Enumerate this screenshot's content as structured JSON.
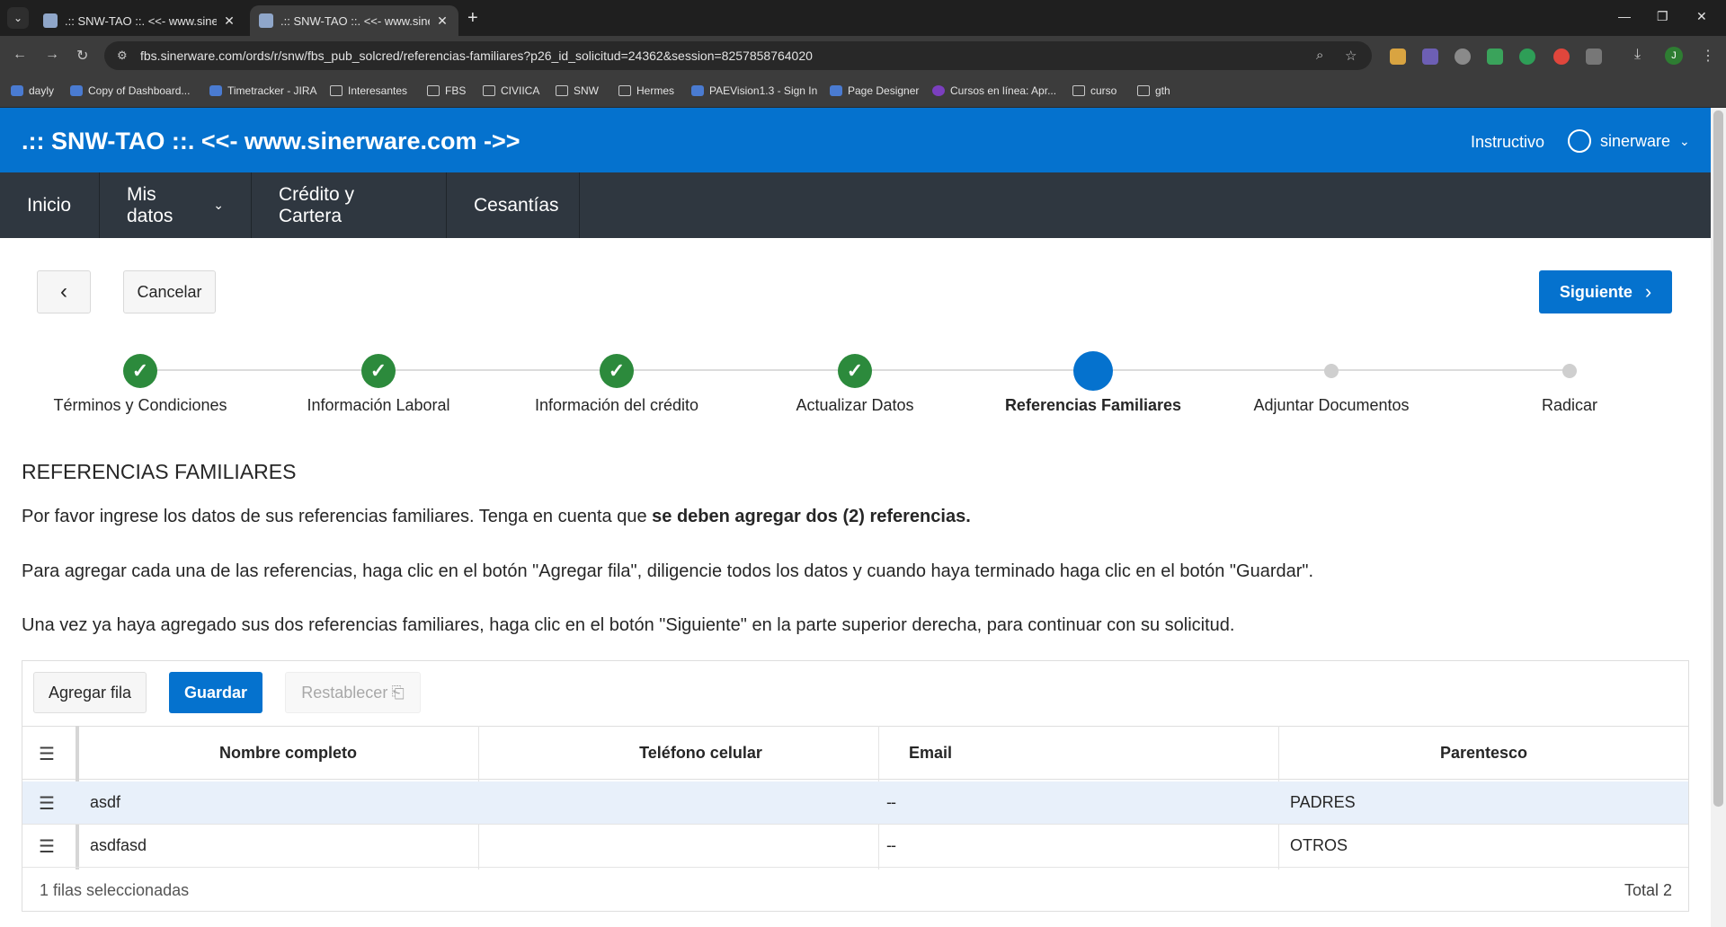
{
  "browser": {
    "tabs": [
      {
        "title": ".:: SNW-TAO ::. <<- www.sinerw"
      },
      {
        "title": ".:: SNW-TAO ::. <<- www.sinerw"
      }
    ],
    "url": "fbs.sinerware.com/ords/r/snw/fbs_pub_solcred/referencias-familiares?p26_id_solicitud=24362&session=8257858764020",
    "profile_initial": "J",
    "bookmarks": [
      "dayly",
      "Copy of Dashboard...",
      "Timetracker - JIRA",
      "Interesantes",
      "FBS",
      "CIVIICA",
      "SNW",
      "Hermes",
      "PAEVision1.3 - Sign In",
      "Page Designer",
      "Cursos en línea: Apr...",
      "curso",
      "gth"
    ]
  },
  "app": {
    "title": ".:: SNW-TAO ::. <<- www.sinerware.com ->>",
    "instructivo": "Instructivo",
    "user": "sinerware",
    "colors": {
      "primary": "#0572ce",
      "menubar": "#2f3740",
      "done": "#2c8a3c"
    }
  },
  "menu": [
    "Inicio",
    "Mis datos",
    "Crédito y Cartera",
    "Cesantías"
  ],
  "buttons": {
    "cancel": "Cancelar",
    "next": "Siguiente"
  },
  "wizard": {
    "steps": [
      {
        "label": "Términos y Condiciones",
        "state": "done"
      },
      {
        "label": "Información Laboral",
        "state": "done"
      },
      {
        "label": "Información del crédito",
        "state": "done"
      },
      {
        "label": "Actualizar Datos",
        "state": "done"
      },
      {
        "label": "Referencias Familiares",
        "state": "current"
      },
      {
        "label": "Adjuntar Documentos",
        "state": "pending"
      },
      {
        "label": "Radicar",
        "state": "pending"
      }
    ]
  },
  "content": {
    "title": "REFERENCIAS FAMILIARES",
    "p1_text": "Por favor ingrese los datos de sus referencias familiares. Tenga en cuenta que ",
    "p1_bold": "se deben agregar dos (2) referencias.",
    "p2": "Para agregar cada una de las referencias, haga clic en el botón \"Agregar fila\", diligencie todos los datos y cuando haya terminado haga clic en el botón \"Guardar\".",
    "p3": "Una vez ya haya agregado sus dos referencias familiares, haga clic en el botón \"Siguiente\" en la parte superior derecha, para continuar con su solicitud."
  },
  "grid": {
    "toolbar": {
      "add": "Agregar fila",
      "save": "Guardar",
      "reset": "Restablecer"
    },
    "columns": [
      "Nombre completo",
      "Teléfono celular",
      "Email",
      "Parentesco"
    ],
    "rows": [
      {
        "nombre": "asdf",
        "telefono": "-",
        "email": "-",
        "parentesco": "PADRES",
        "selected": true
      },
      {
        "nombre": "asdfasd",
        "telefono": "-",
        "email": "-",
        "parentesco": "OTROS",
        "selected": false
      }
    ],
    "footer": {
      "selected": "1 filas seleccionadas",
      "total": "Total 2"
    }
  }
}
